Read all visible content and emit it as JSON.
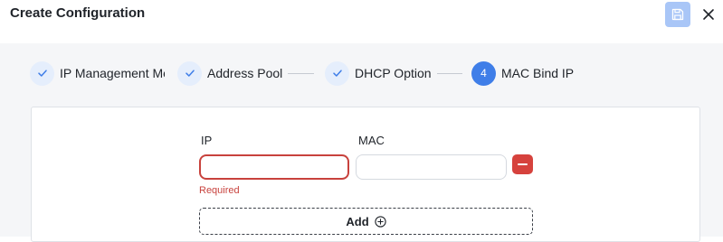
{
  "header": {
    "title": "Create Configuration",
    "save_icon": "save-icon",
    "close_icon": "close-icon"
  },
  "steps": [
    {
      "label": "IP Management Method",
      "status": "done",
      "icon": "check-icon"
    },
    {
      "label": "Address Pool",
      "status": "done",
      "icon": "check-icon"
    },
    {
      "label": "DHCP Option",
      "status": "done",
      "icon": "check-icon"
    },
    {
      "label": "MAC Bind IP",
      "status": "active",
      "number": "4"
    }
  ],
  "form": {
    "ip_label": "IP",
    "mac_label": "MAC",
    "ip_value": "",
    "mac_value": "",
    "ip_error": "Required",
    "add_label": "Add"
  },
  "colors": {
    "accent": "#3f7ee8",
    "error": "#c8423d",
    "save_button": "#a9c6f7"
  }
}
